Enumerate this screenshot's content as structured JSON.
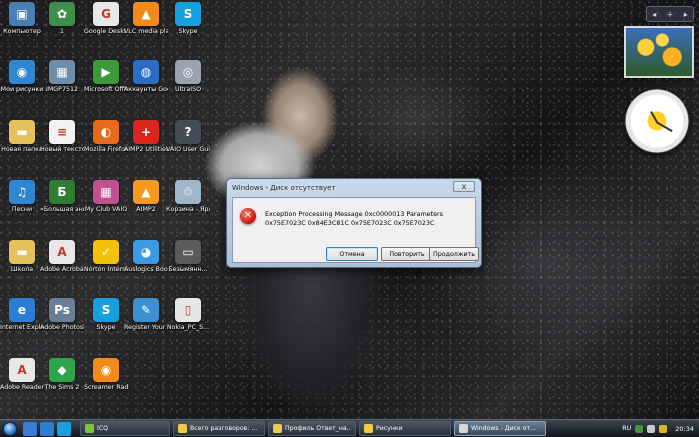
{
  "desktop": {
    "icons": [
      {
        "label": "Компьютер",
        "icon": "computer-icon",
        "color": "#4a7fb5",
        "glyph": "▣"
      },
      {
        "label": "1",
        "icon": "image-icon",
        "color": "#3e8f4a",
        "glyph": "✿"
      },
      {
        "label": "Google Deskt...",
        "icon": "google-desktop-icon",
        "color": "#e8e8e8",
        "glyph": "G"
      },
      {
        "label": "VLC media player",
        "icon": "vlc-icon",
        "color": "#f28a1a",
        "glyph": "▲"
      },
      {
        "label": "Skype",
        "icon": "skype-icon",
        "color": "#16a0e0",
        "glyph": "S"
      },
      {
        "label": "Мои рисунки",
        "icon": "pictures-folder-icon",
        "color": "#2f86d1",
        "glyph": "◉"
      },
      {
        "label": "IMGP7512",
        "icon": "photo-icon",
        "color": "#6e8da8",
        "glyph": "▦"
      },
      {
        "label": "Microsoft Office - 60...",
        "icon": "office-icon",
        "color": "#3b9b3a",
        "glyph": "▶"
      },
      {
        "label": "Аккаунты Google",
        "icon": "google-earth-icon",
        "color": "#2b6cc4",
        "glyph": "◍"
      },
      {
        "label": "UltraISO",
        "icon": "disc-icon",
        "color": "#9aa3ad",
        "glyph": "◎"
      },
      {
        "label": "Новая папка",
        "icon": "folder-icon",
        "color": "#e5c25a",
        "glyph": "▬"
      },
      {
        "label": "Новый текстов...",
        "icon": "text-file-icon",
        "color": "#f3f3f3",
        "glyph": "≡"
      },
      {
        "label": "Mozilla Firefox",
        "icon": "firefox-icon",
        "color": "#e66a1a",
        "glyph": "◐"
      },
      {
        "label": "AIMP2 Utilities",
        "icon": "aimp-utilities-icon",
        "color": "#d9251b",
        "glyph": "+"
      },
      {
        "label": "VAIO User Guide",
        "icon": "help-icon",
        "color": "#444b55",
        "glyph": "?"
      },
      {
        "label": "Песни",
        "icon": "music-folder-icon",
        "color": "#2f86d1",
        "glyph": "♫"
      },
      {
        "label": "«Большая энциклоп...",
        "icon": "encyclopedia-icon",
        "color": "#2e7d32",
        "glyph": "Б"
      },
      {
        "label": "My Club VAIO",
        "icon": "club-vaio-icon",
        "color": "#c24f8f",
        "glyph": "▦"
      },
      {
        "label": "AIMP2",
        "icon": "aimp-icon",
        "color": "#f39a1c",
        "glyph": "▲"
      },
      {
        "label": "Корзина - Ярлык",
        "icon": "recycle-bin-icon",
        "color": "#9fb6c9",
        "glyph": "♲"
      },
      {
        "label": "Школа",
        "icon": "folder-icon",
        "color": "#e5c25a",
        "glyph": "▬"
      },
      {
        "label": "Adobe Acroba...",
        "icon": "acrobat-icon",
        "color": "#e8e8e8",
        "glyph": "A"
      },
      {
        "label": "Norton Intern...",
        "icon": "norton-icon",
        "color": "#f4c20d",
        "glyph": "✓"
      },
      {
        "label": "Auslogics BoostSpeed",
        "icon": "boostspeed-icon",
        "color": "#3a9be0",
        "glyph": "◕"
      },
      {
        "label": "Безымянн...",
        "icon": "video-icon",
        "color": "#5a5a5a",
        "glyph": "▭"
      },
      {
        "label": "Internet Explorer",
        "icon": "ie-icon",
        "color": "#2a7fd4",
        "glyph": "e"
      },
      {
        "label": "Adobe Photosh...",
        "icon": "photoshop-icon",
        "color": "#6a7f96",
        "glyph": "Ps"
      },
      {
        "label": "Skype",
        "icon": "skype-icon",
        "color": "#16a0e0",
        "glyph": "S"
      },
      {
        "label": "Register Your VAIO",
        "icon": "register-icon",
        "color": "#3c8fd0",
        "glyph": "✎"
      },
      {
        "label": "Nokia_PC_S...",
        "icon": "nokia-icon",
        "color": "#e7e7e7",
        "glyph": "▯"
      },
      {
        "label": "Adobe Reader 9",
        "icon": "reader-icon",
        "color": "#e8e8e8",
        "glyph": "A"
      },
      {
        "label": "The Sims 2",
        "icon": "sims-icon",
        "color": "#2da34a",
        "glyph": "◆"
      },
      {
        "label": "Screamer Radio",
        "icon": "radio-icon",
        "color": "#f08a1a",
        "glyph": "◉"
      }
    ]
  },
  "dialog": {
    "title": "Windows - Диск отсутствует",
    "close_label": "x",
    "error_glyph": "✕",
    "message": "Exception Processing Message 0xc0000013 Parameters 0x75E7023C 0x84E3C81C 0x75E7023C 0x75E7023C",
    "buttons": {
      "cancel": "Отмена",
      "retry": "Повторить",
      "continue": "Продолжить"
    }
  },
  "gadgets": {
    "top_add": "+",
    "top_prev": "◂",
    "top_next": "▸"
  },
  "taskbar": {
    "tasks": [
      {
        "label": "ICQ",
        "color": "#7fc241"
      },
      {
        "label": "Всего разговоров: ...",
        "color": "#f2c94c"
      },
      {
        "label": "Профиль Ответ_на...",
        "color": "#f2c94c"
      },
      {
        "label": "Рисунки",
        "color": "#f2c94c"
      },
      {
        "label": "Windows - Диск от...",
        "color": "#d9d9d9",
        "active": true
      }
    ],
    "lang": "RU",
    "time": "20:34"
  },
  "colors": {
    "dialog_frame": "#a9bed6",
    "error_red": "#c8120b",
    "taskbar": "#12161b"
  }
}
